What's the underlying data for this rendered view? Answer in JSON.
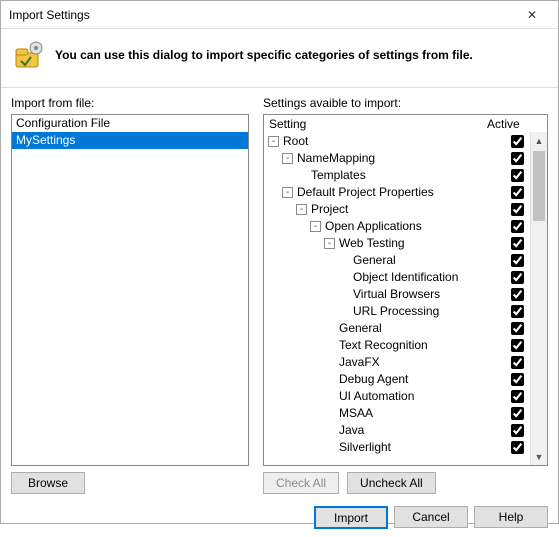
{
  "window": {
    "title": "Import Settings",
    "close_icon": "✕"
  },
  "banner": {
    "text": "You can use this dialog to import specific categories of settings from file."
  },
  "left": {
    "label": "Import from file:",
    "files": [
      {
        "name": "Configuration File",
        "selected": false
      },
      {
        "name": "MySettings",
        "selected": true
      }
    ],
    "browse_label": "Browse"
  },
  "right": {
    "label": "Settings avaible to import:",
    "header_setting": "Setting",
    "header_active": "Active",
    "tree": [
      {
        "level": 0,
        "expand": "-",
        "label": "Root",
        "checked": true
      },
      {
        "level": 1,
        "expand": "-",
        "label": "NameMapping",
        "checked": true
      },
      {
        "level": 2,
        "expand": "",
        "label": "Templates",
        "checked": true
      },
      {
        "level": 1,
        "expand": "-",
        "label": "Default Project Properties",
        "checked": true
      },
      {
        "level": 2,
        "expand": "-",
        "label": "Project",
        "checked": true
      },
      {
        "level": 3,
        "expand": "-",
        "label": "Open Applications",
        "checked": true
      },
      {
        "level": 4,
        "expand": "-",
        "label": "Web Testing",
        "checked": true
      },
      {
        "level": 5,
        "expand": "",
        "label": "General",
        "checked": true
      },
      {
        "level": 5,
        "expand": "",
        "label": "Object Identification",
        "checked": true
      },
      {
        "level": 5,
        "expand": "",
        "label": "Virtual Browsers",
        "checked": true
      },
      {
        "level": 5,
        "expand": "",
        "label": "URL Processing",
        "checked": true
      },
      {
        "level": 4,
        "expand": "",
        "label": "General",
        "checked": true
      },
      {
        "level": 4,
        "expand": "",
        "label": "Text Recognition",
        "checked": true
      },
      {
        "level": 4,
        "expand": "",
        "label": "JavaFX",
        "checked": true
      },
      {
        "level": 4,
        "expand": "",
        "label": "Debug Agent",
        "checked": true
      },
      {
        "level": 4,
        "expand": "",
        "label": "UI Automation",
        "checked": true
      },
      {
        "level": 4,
        "expand": "",
        "label": "MSAA",
        "checked": true
      },
      {
        "level": 4,
        "expand": "",
        "label": "Java",
        "checked": true
      },
      {
        "level": 4,
        "expand": "",
        "label": "Silverlight",
        "checked": true
      }
    ],
    "check_all_label": "Check All",
    "uncheck_all_label": "Uncheck All"
  },
  "footer": {
    "import_label": "Import",
    "cancel_label": "Cancel",
    "help_label": "Help"
  }
}
